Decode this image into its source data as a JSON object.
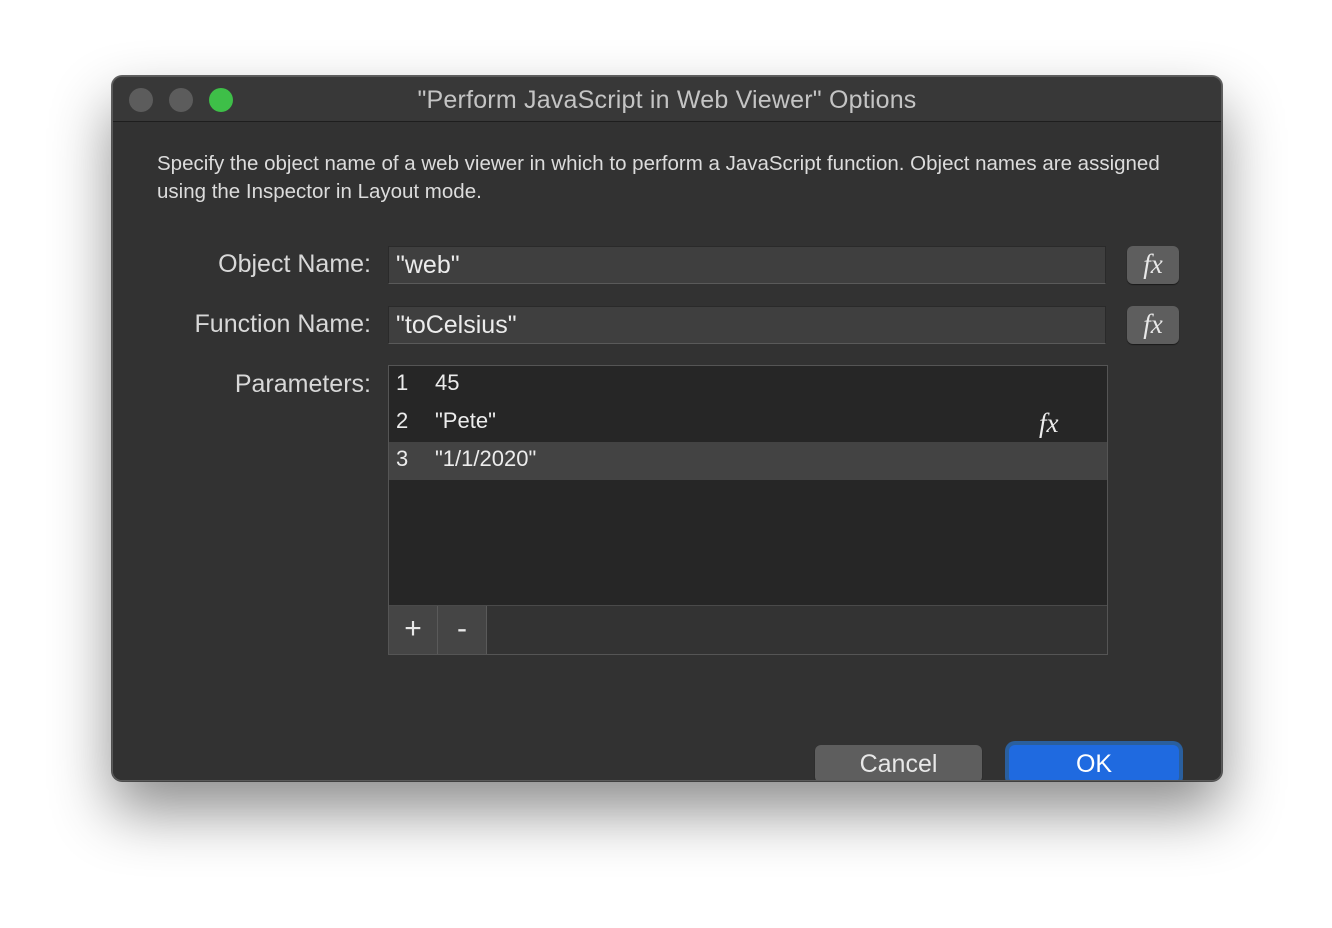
{
  "window": {
    "title": "\"Perform JavaScript in Web Viewer\" Options"
  },
  "description": "Specify the object name of a web viewer in which to perform a JavaScript function. Object names are assigned using the Inspector in Layout mode.",
  "object_name": {
    "label": "Object Name:",
    "value": "\"web\"",
    "fx_label": "fx"
  },
  "function_name": {
    "label": "Function Name:",
    "value": "\"toCelsius\"",
    "fx_label": "fx"
  },
  "parameters": {
    "label": "Parameters:",
    "rows": [
      {
        "num": "1",
        "value": "45"
      },
      {
        "num": "2",
        "value": "\"Pete\"",
        "fx": "fx"
      },
      {
        "num": "3",
        "value": "\"1/1/2020\""
      }
    ],
    "selected_row": 3,
    "add_label": "+",
    "remove_label": "-"
  },
  "buttons": {
    "cancel": "Cancel",
    "ok": "OK"
  },
  "colors": {
    "accent": "#1f6ae0",
    "zoom_button": "#3ebf48"
  },
  "icons": {
    "close": "close-icon",
    "minimize": "minimize-icon",
    "zoom": "zoom-icon",
    "formula": "fx-icon"
  }
}
